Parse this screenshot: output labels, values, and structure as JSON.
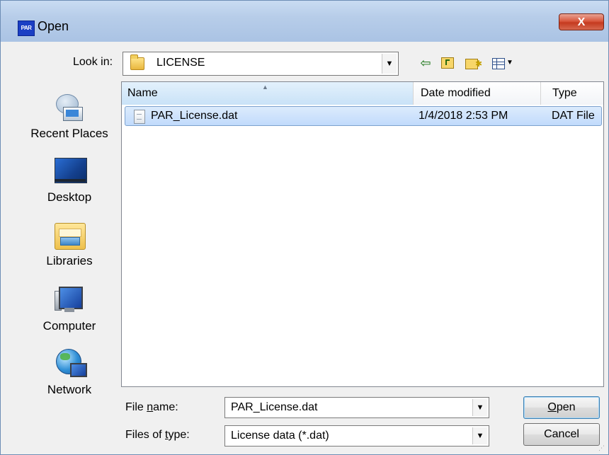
{
  "window": {
    "title": "Open",
    "app_icon_text": "PAR",
    "close_glyph": "X"
  },
  "toolbar": {
    "look_in_label": "Look in:",
    "look_in_value": "LICENSE",
    "icons": [
      "back-icon",
      "up-one-level-icon",
      "new-folder-icon",
      "view-menu-icon"
    ]
  },
  "places": [
    {
      "label": "Recent Places",
      "icon": "recent-places-icon"
    },
    {
      "label": "Desktop",
      "icon": "desktop-icon"
    },
    {
      "label": "Libraries",
      "icon": "libraries-icon"
    },
    {
      "label": "Computer",
      "icon": "computer-icon"
    },
    {
      "label": "Network",
      "icon": "network-icon"
    }
  ],
  "filelist": {
    "columns": [
      "Name",
      "Date modified",
      "Type"
    ],
    "rows": [
      {
        "name": "PAR_License.dat",
        "date_modified": "1/4/2018 2:53 PM",
        "type": "DAT File",
        "selected": true
      }
    ]
  },
  "file_name": {
    "label_prefix": "File ",
    "label_underlined": "n",
    "label_suffix": "ame:",
    "value": "PAR_License.dat"
  },
  "file_type": {
    "label_prefix": "Files of ",
    "label_underlined": "t",
    "label_suffix": "ype:",
    "value": "License data (*.dat)"
  },
  "buttons": {
    "open_underlined": "O",
    "open_rest": "pen",
    "cancel": "Cancel"
  },
  "colors": {
    "selection": "#c1dbfc",
    "title_bar": "#b7cde9",
    "close_button": "#c53a1f"
  }
}
